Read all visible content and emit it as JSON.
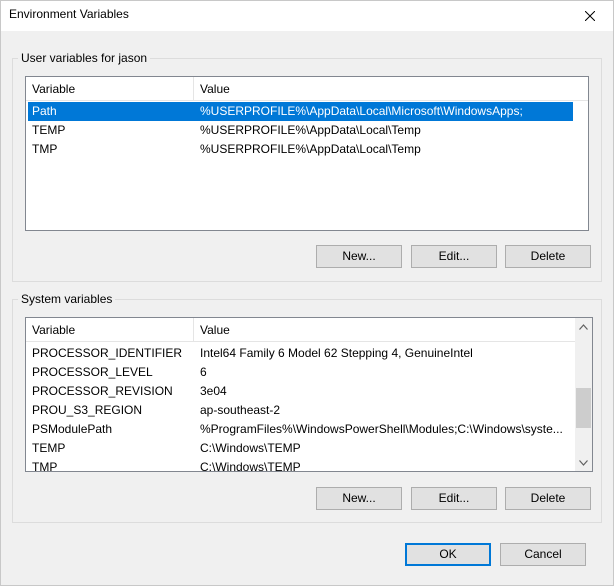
{
  "window": {
    "title": "Environment Variables"
  },
  "user_vars": {
    "group_label": "User variables for jason",
    "columns": [
      "Variable",
      "Value"
    ],
    "rows": [
      {
        "variable": "Path",
        "value": "%USERPROFILE%\\AppData\\Local\\Microsoft\\WindowsApps;"
      },
      {
        "variable": "TEMP",
        "value": "%USERPROFILE%\\AppData\\Local\\Temp"
      },
      {
        "variable": "TMP",
        "value": "%USERPROFILE%\\AppData\\Local\\Temp"
      }
    ],
    "selected_index": 0,
    "buttons": {
      "new": "New...",
      "edit": "Edit...",
      "delete": "Delete"
    }
  },
  "system_vars": {
    "group_label": "System variables",
    "columns": [
      "Variable",
      "Value"
    ],
    "rows": [
      {
        "variable": "PROCESSOR_IDENTIFIER",
        "value": "Intel64 Family 6 Model 62 Stepping 4, GenuineIntel"
      },
      {
        "variable": "PROCESSOR_LEVEL",
        "value": "6"
      },
      {
        "variable": "PROCESSOR_REVISION",
        "value": "3e04"
      },
      {
        "variable": "PROU_S3_REGION",
        "value": "ap-southeast-2"
      },
      {
        "variable": "PSModulePath",
        "value": "%ProgramFiles%\\WindowsPowerShell\\Modules;C:\\Windows\\syste..."
      },
      {
        "variable": "TEMP",
        "value": "C:\\Windows\\TEMP"
      },
      {
        "variable": "TMP",
        "value": "C:\\Windows\\TEMP"
      }
    ],
    "buttons": {
      "new": "New...",
      "edit": "Edit...",
      "delete": "Delete"
    }
  },
  "dialog_buttons": {
    "ok": "OK",
    "cancel": "Cancel"
  },
  "colors": {
    "selection": "#0078d7",
    "window_bg": "#f0f0f0",
    "list_border": "#828790"
  }
}
